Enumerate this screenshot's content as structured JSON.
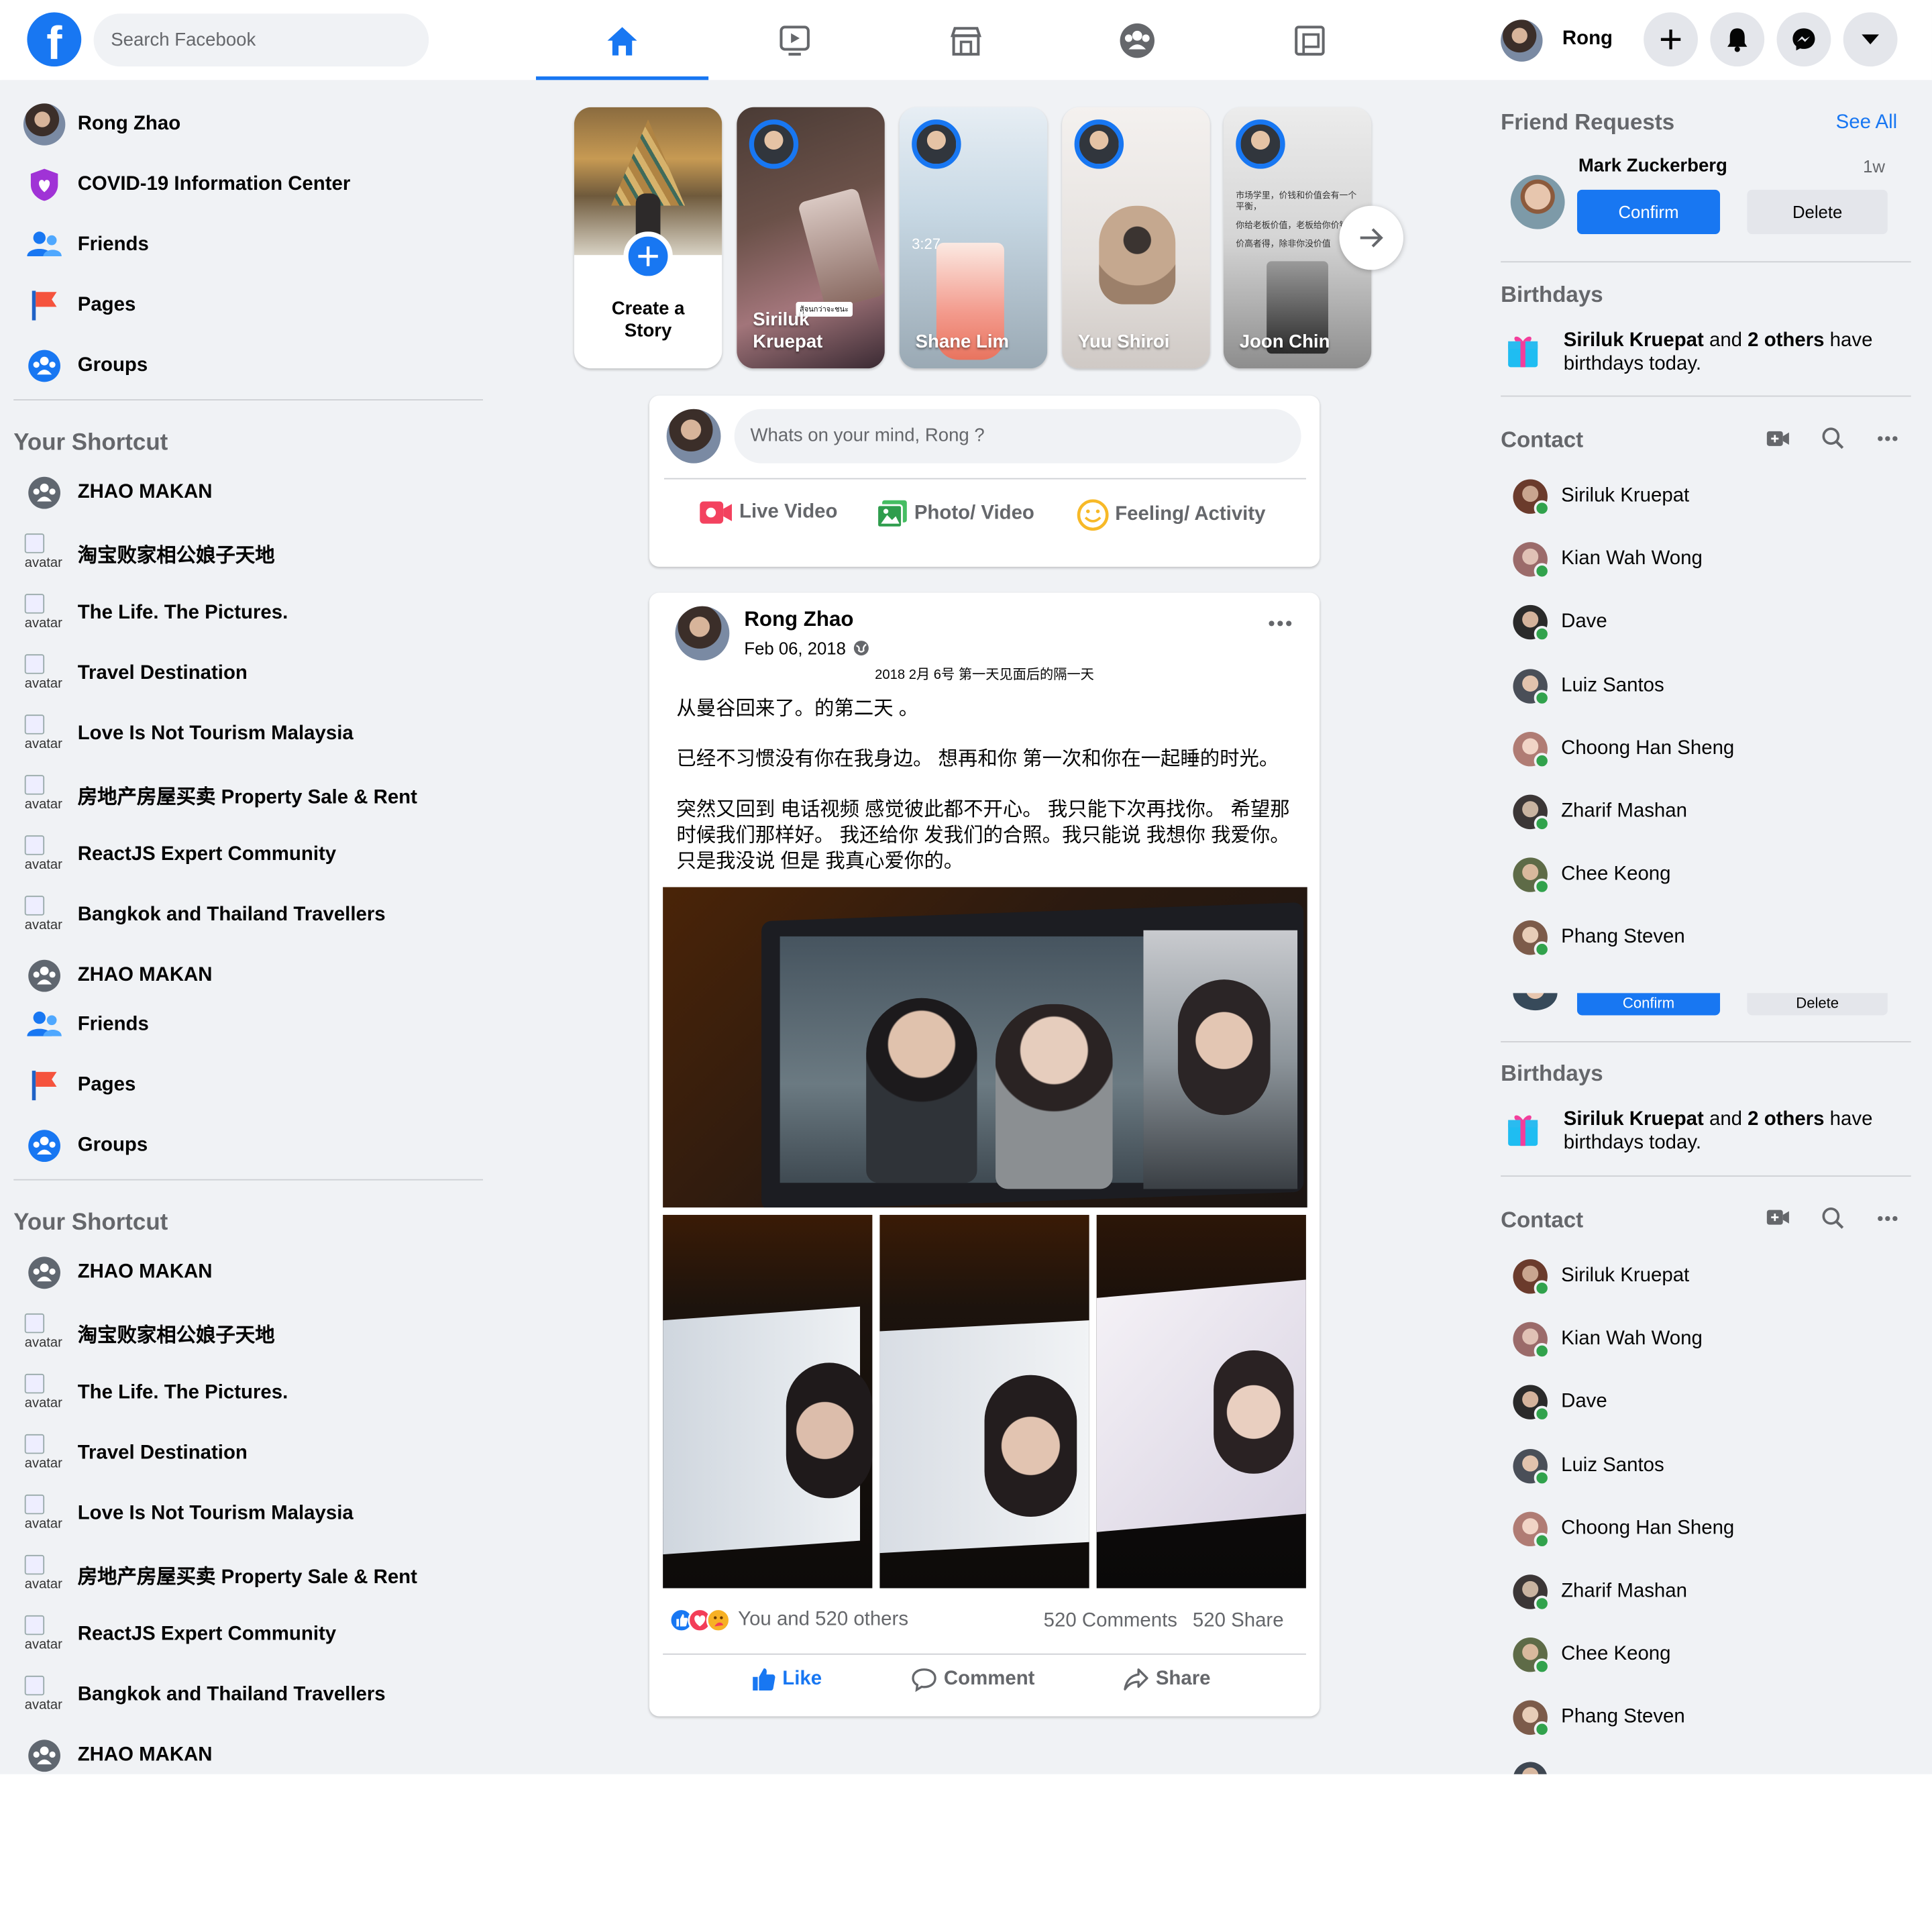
{
  "header": {
    "logo": "f",
    "search_placeholder": "Search Facebook",
    "user_name": "Rong",
    "nav_tabs": [
      {
        "name": "home-icon",
        "active": true
      },
      {
        "name": "watch-icon",
        "active": false
      },
      {
        "name": "marketplace-icon",
        "active": false
      },
      {
        "name": "groups-icon",
        "active": false
      },
      {
        "name": "gaming-icon",
        "active": false
      }
    ],
    "accent_color": "#1877f2"
  },
  "sidebar": {
    "profile_name": "Rong Zhao",
    "main_items": [
      "COVID-19 Information Center",
      "Friends",
      "Pages",
      "Groups"
    ],
    "shortcut_title": "Your Shortcut",
    "shortcuts": [
      "ZHAO MAKAN",
      "淘宝败家相公娘子天地",
      "The Life. The Pictures.",
      "Travel Destination",
      "Love Is Not Tourism Malaysia",
      "房地产房屋买卖 Property Sale & Rent",
      "ReactJS Expert Community",
      "Bangkok and Thailand Travellers",
      "ZHAO MAKAN"
    ],
    "repeat_items": [
      "Friends",
      "Pages",
      "Groups"
    ],
    "broken_image_alt": "avatar"
  },
  "stories": {
    "create_label": "Create a Story",
    "items": [
      {
        "name": "Siriluk Kruepat"
      },
      {
        "name": "Shane Lim"
      },
      {
        "name": "Yuu Shiroi"
      },
      {
        "name": "Joon Chin"
      }
    ],
    "story_texts": {
      "siriluk_sticker": "สู้จนกว่าจะชนะ",
      "shane_time": "3:27",
      "joon_lines": [
        "市场学里，价钱和价值会有一个平衡，",
        "你给老板价值，老板给你价钱，",
        "价高者得，除非你没价值"
      ]
    }
  },
  "composer": {
    "placeholder": "Whats on your mind, Rong ?",
    "actions": [
      "Live Video",
      "Photo/ Video",
      "Feeling/ Activity"
    ]
  },
  "post": {
    "author": "Rong Zhao",
    "date": "Feb 06, 2018",
    "caption_small": "2018 2月 6号 第一天见面后的隔一天",
    "lines": [
      "从曼谷回来了。的第二天 。",
      "已经不习惯没有你在我身边。 想再和你 第一次和你在一起睡的时光。",
      "突然又回到 电话视频 感觉彼此都不开心。 我只能下次再找你。 希望那时候我们那样好。 我还给你 发我们的合照。我只能说 我想你 我爱你。 只是我没说 但是 我真心爱你的。"
    ],
    "reactions_text": "You and 520 others",
    "comments_text": "520 Comments",
    "shares_text": "520 Share",
    "buttons": [
      "Like",
      "Comment",
      "Share"
    ],
    "more_icon": "more-icon"
  },
  "right": {
    "friend_requests_title": "Friend Requests",
    "see_all": "See All",
    "request": {
      "name": "Mark Zuckerberg",
      "time": "1w",
      "confirm": "Confirm",
      "delete": "Delete"
    },
    "birthdays_title": "Birthdays",
    "birthday": {
      "bold1": "Siriluk Kruepat",
      "mid": " and ",
      "bold2": "2 others",
      "rest": " have birthdays today."
    },
    "contact_title": "Contact",
    "contacts": [
      "Siriluk Kruepat",
      "Kian Wah Wong",
      "Dave",
      "Luiz Santos",
      "Choong Han Sheng",
      "Zharif Mashan",
      "Chee Keong",
      "Phang Steven"
    ],
    "partial_buttons": [
      "Confirm",
      "Delete"
    ],
    "online_color": "#31a24c"
  }
}
